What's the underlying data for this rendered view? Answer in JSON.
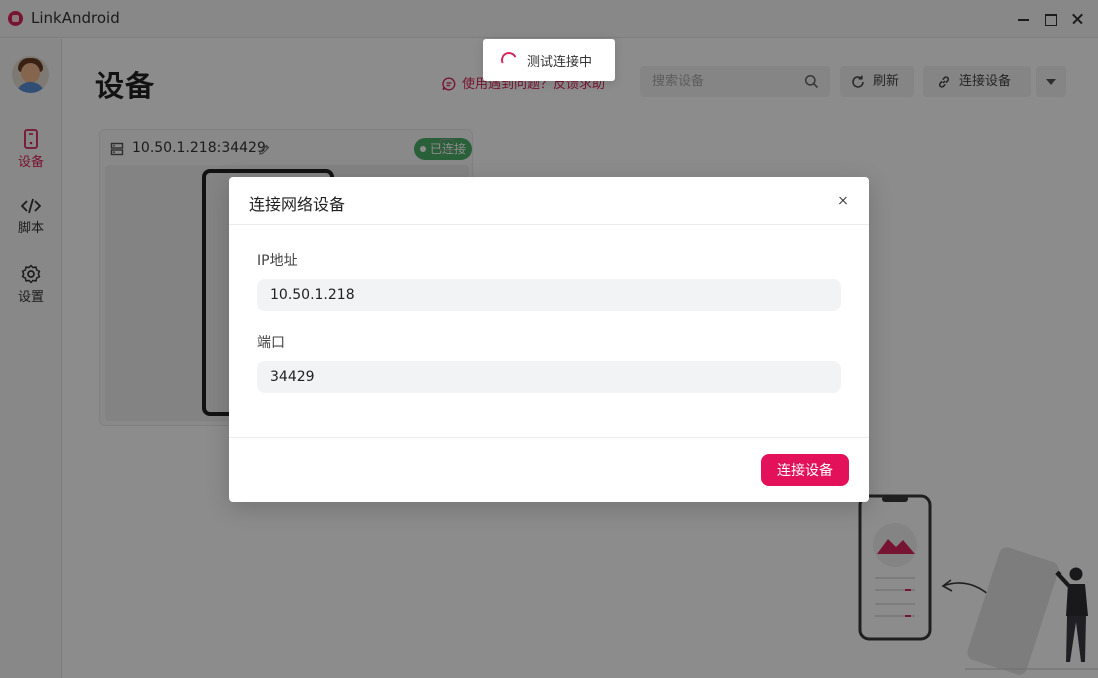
{
  "window": {
    "title": "LinkAndroid"
  },
  "sidebar": {
    "items": [
      {
        "label": "设备",
        "icon": "phone-icon",
        "active": true
      },
      {
        "label": "脚本",
        "icon": "code-icon",
        "active": false
      },
      {
        "label": "设置",
        "icon": "gear-icon",
        "active": false
      }
    ]
  },
  "header": {
    "title": "设备",
    "help_link": "使用遇到问题？反馈求助",
    "search_placeholder": "搜索设备",
    "refresh_label": "刷新",
    "connect_label": "连接设备"
  },
  "device": {
    "address": "10.50.1.218:34429",
    "status": "已连接",
    "status_color": "#4caf69"
  },
  "toast": {
    "text": "测试连接中"
  },
  "modal": {
    "title": "连接网络设备",
    "ip_label": "IP地址",
    "ip_value": "10.50.1.218",
    "port_label": "端口",
    "port_value": "34429",
    "submit_label": "连接设备"
  },
  "theme": {
    "accent": "#d9265a",
    "primary_button": "#e3105a"
  }
}
